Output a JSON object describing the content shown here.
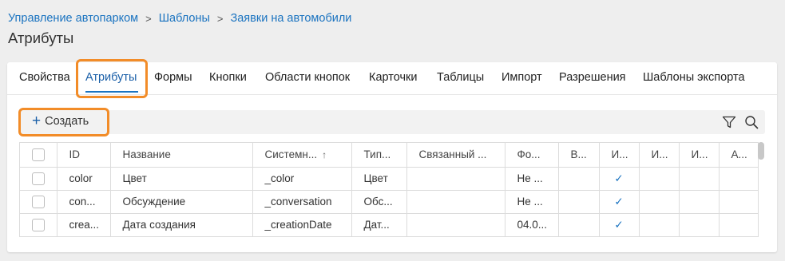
{
  "breadcrumb": {
    "items": [
      "Управление автопарком",
      "Шаблоны",
      "Заявки на автомобили"
    ],
    "separator": ">"
  },
  "page_title": "Атрибуты",
  "tabs": [
    {
      "label": "Свойства"
    },
    {
      "label": "Атрибуты",
      "active": true
    },
    {
      "label": "Формы"
    },
    {
      "label": "Кнопки"
    },
    {
      "label": "Области кнопок"
    },
    {
      "label": "Карточки"
    },
    {
      "label": "Таблицы"
    },
    {
      "label": "Импорт"
    },
    {
      "label": "Разрешения"
    },
    {
      "label": "Шаблоны экспорта"
    }
  ],
  "toolbar": {
    "create_label": "Создать",
    "filter_icon": "filter-icon",
    "search_icon": "search-icon"
  },
  "table": {
    "columns": [
      "",
      "ID",
      "Название",
      "Системн...",
      "Тип...",
      "Связанный ...",
      "Фо...",
      "В...",
      "И...",
      "И...",
      "И...",
      "А..."
    ],
    "sorted_column": "Системн...",
    "sort_direction": "asc",
    "rows": [
      {
        "cells": [
          "",
          "color",
          "Цвет",
          "_color",
          "Цвет",
          "",
          "Не ...",
          "",
          "✓",
          "",
          "",
          ""
        ]
      },
      {
        "cells": [
          "",
          "con...",
          "Обсуждение",
          "_conversation",
          "Обс...",
          "",
          "Не ...",
          "",
          "✓",
          "",
          "",
          ""
        ]
      },
      {
        "cells": [
          "",
          "crea...",
          "Дата создания",
          "_creationDate",
          "Дат...",
          "",
          "04.0...",
          "",
          "✓",
          "",
          "",
          ""
        ]
      }
    ]
  },
  "colors": {
    "accent": "#1a73c0",
    "highlight": "#f28c28"
  }
}
